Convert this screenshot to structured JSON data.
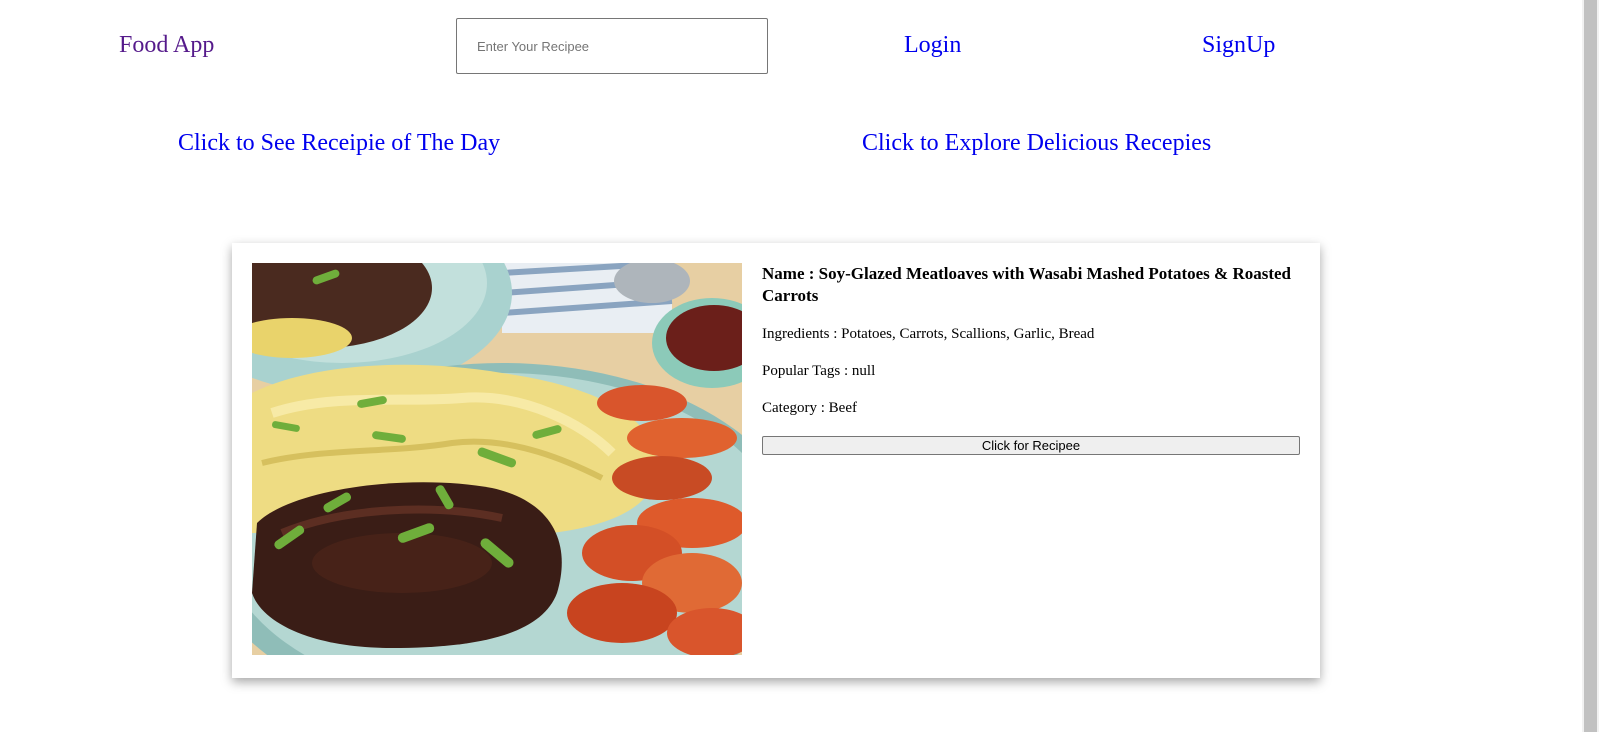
{
  "header": {
    "brand": "Food App",
    "search_placeholder": "Enter Your Recipee",
    "login": "Login",
    "signup": "SignUp"
  },
  "links": {
    "recipe_of_day": "Click to See Receipie of The Day",
    "explore": "Click to Explore Delicious Recepies"
  },
  "card": {
    "image_alt": "Soy-Glazed Meatloaves with Wasabi Mashed Potatoes & Roasted Carrots",
    "name": "Name : Soy-Glazed Meatloaves with Wasabi Mashed Potatoes & Roasted Carrots",
    "ingredients": "Ingredients : Potatoes, Carrots, Scallions, Garlic, Bread",
    "tags": "Popular Tags : null",
    "category": "Category : Beef",
    "button": "Click for Recipee"
  }
}
